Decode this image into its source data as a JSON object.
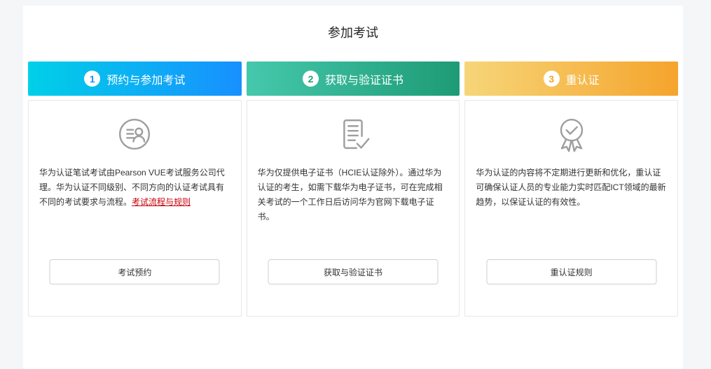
{
  "page": {
    "title": "参加考试",
    "background": "#f5f6f7"
  },
  "colors": {
    "link_red": "#c7000b",
    "icon_gray": "#9e9e9e",
    "body_text": "#333333"
  },
  "cards": [
    {
      "step_number": "1",
      "header": "预约与参加考试",
      "gradient_start": "#00d0e8",
      "gradient_end": "#1890ff",
      "number_color": "#1890ff",
      "icon": "registration-profile-icon",
      "body": "华为认证笔试考试由Pearson VUE考试服务公司代理。华为认证不同级别、不同方向的认证考试具有不同的考试要求与流程。",
      "link": "考试流程与规则",
      "button": "考试预约"
    },
    {
      "step_number": "2",
      "header": "获取与验证证书",
      "gradient_start": "#45c8ac",
      "gradient_end": "#1e9b76",
      "number_color": "#23a27e",
      "icon": "certificate-document-icon",
      "body": "华为仅提供电子证书（HCIE认证除外）。通过华为认证的考生，如需下载华为电子证书，可在完成相关考试的一个工作日后访问华为官网下载电子证书。",
      "link": "",
      "button": "获取与验证证书"
    },
    {
      "step_number": "3",
      "header": "重认证",
      "gradient_start": "#f6d679",
      "gradient_end": "#f5a42c",
      "number_color": "#f5a42c",
      "icon": "medal-check-icon",
      "body": "华为认证的内容将不定期进行更新和优化，重认证可确保认证人员的专业能力实时匹配ICT领域的最新趋势，以保证认证的有效性。",
      "link": "",
      "button": "重认证规则"
    }
  ]
}
